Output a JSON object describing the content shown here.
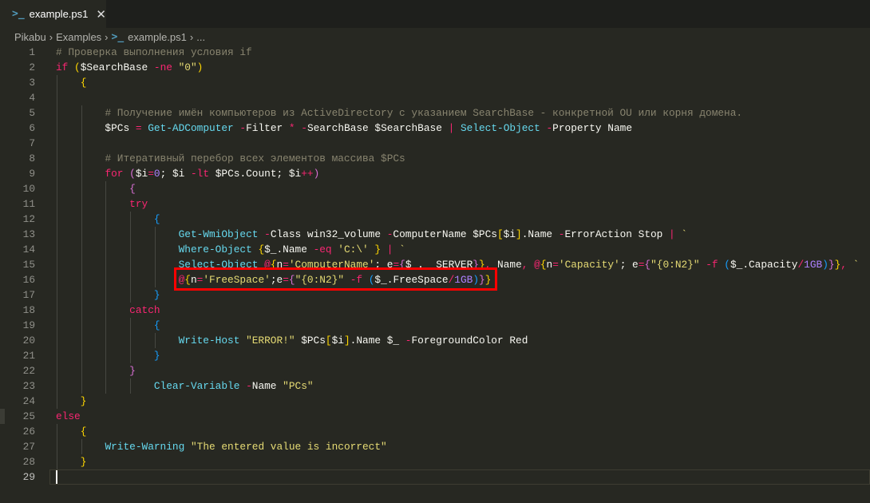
{
  "tab": {
    "icon": "powershell-icon",
    "title": "example.ps1",
    "close_icon": "close-icon"
  },
  "breadcrumb": [
    "Pikabu",
    "Examples",
    "example.ps1",
    "..."
  ],
  "editor": {
    "current_line": 29,
    "highlight_box_line": 16,
    "lines": [
      [
        [
          "c",
          "# Проверка выполнения условия if"
        ]
      ],
      [
        [
          "k",
          "if"
        ],
        [
          "v",
          " "
        ],
        [
          "b1",
          "("
        ],
        [
          "v",
          "$SearchBase "
        ],
        [
          "k",
          "-ne"
        ],
        [
          "v",
          " "
        ],
        [
          "s",
          "\"0\""
        ],
        [
          "b1",
          ")"
        ]
      ],
      [
        [
          "v",
          "    "
        ],
        [
          "b1",
          "{"
        ]
      ],
      [],
      [
        [
          "v",
          "        "
        ],
        [
          "c",
          "# Получение имён компьютеров из ActiveDirectory с указанием SearchBase - конкретной OU или корня домена."
        ]
      ],
      [
        [
          "v",
          "        $PCs "
        ],
        [
          "k",
          "="
        ],
        [
          "v",
          " "
        ],
        [
          "f",
          "Get-ADComputer"
        ],
        [
          "v",
          " "
        ],
        [
          "k",
          "-"
        ],
        [
          "v",
          "Filter "
        ],
        [
          "k",
          "*"
        ],
        [
          "v",
          " "
        ],
        [
          "k",
          "-"
        ],
        [
          "v",
          "SearchBase $SearchBase "
        ],
        [
          "k",
          "|"
        ],
        [
          "v",
          " "
        ],
        [
          "f",
          "Select-Object"
        ],
        [
          "v",
          " "
        ],
        [
          "k",
          "-"
        ],
        [
          "v",
          "Property Name"
        ]
      ],
      [],
      [
        [
          "v",
          "        "
        ],
        [
          "c",
          "# Итеративный перебор всех элементов массива $PCs"
        ]
      ],
      [
        [
          "v",
          "        "
        ],
        [
          "k",
          "for"
        ],
        [
          "v",
          " "
        ],
        [
          "b2",
          "("
        ],
        [
          "v",
          "$i"
        ],
        [
          "k",
          "="
        ],
        [
          "n",
          "0"
        ],
        [
          "v",
          "; $i "
        ],
        [
          "k",
          "-lt"
        ],
        [
          "v",
          " $PCs.Count; $i"
        ],
        [
          "k",
          "++"
        ],
        [
          "b2",
          ")"
        ]
      ],
      [
        [
          "v",
          "            "
        ],
        [
          "b2",
          "{"
        ]
      ],
      [
        [
          "v",
          "            "
        ],
        [
          "k",
          "try"
        ]
      ],
      [
        [
          "v",
          "                "
        ],
        [
          "b3",
          "{"
        ]
      ],
      [
        [
          "v",
          "                    "
        ],
        [
          "f",
          "Get-WmiObject"
        ],
        [
          "v",
          " "
        ],
        [
          "k",
          "-"
        ],
        [
          "v",
          "Class win32_volume "
        ],
        [
          "k",
          "-"
        ],
        [
          "v",
          "ComputerName $PCs"
        ],
        [
          "b1",
          "["
        ],
        [
          "v",
          "$i"
        ],
        [
          "b1",
          "]"
        ],
        [
          "v",
          ".Name "
        ],
        [
          "k",
          "-"
        ],
        [
          "v",
          "ErrorAction Stop "
        ],
        [
          "k",
          "|"
        ],
        [
          "v",
          " "
        ],
        [
          "s",
          "`"
        ]
      ],
      [
        [
          "v",
          "                    "
        ],
        [
          "f",
          "Where-Object"
        ],
        [
          "v",
          " "
        ],
        [
          "b1",
          "{"
        ],
        [
          "v",
          "$_.Name "
        ],
        [
          "k",
          "-eq"
        ],
        [
          "v",
          " "
        ],
        [
          "s",
          "'C:\\'"
        ],
        [
          "v",
          " "
        ],
        [
          "b1",
          "}"
        ],
        [
          "v",
          " "
        ],
        [
          "k",
          "|"
        ],
        [
          "v",
          " "
        ],
        [
          "s",
          "`"
        ]
      ],
      [
        [
          "v",
          "                    "
        ],
        [
          "f",
          "Select-Object"
        ],
        [
          "v",
          " "
        ],
        [
          "k",
          "@"
        ],
        [
          "b1",
          "{"
        ],
        [
          "v",
          "n"
        ],
        [
          "k",
          "="
        ],
        [
          "s",
          "'ComputerName'"
        ],
        [
          "v",
          "; e"
        ],
        [
          "k",
          "="
        ],
        [
          "b2",
          "{"
        ],
        [
          "v",
          "$_.__SERVER"
        ],
        [
          "b2",
          "}"
        ],
        [
          "b1",
          "}"
        ],
        [
          "k",
          ","
        ],
        [
          "v",
          " Name"
        ],
        [
          "k",
          ","
        ],
        [
          "v",
          " "
        ],
        [
          "k",
          "@"
        ],
        [
          "b1",
          "{"
        ],
        [
          "v",
          "n"
        ],
        [
          "k",
          "="
        ],
        [
          "s",
          "'Capacity'"
        ],
        [
          "v",
          "; e"
        ],
        [
          "k",
          "="
        ],
        [
          "b2",
          "{"
        ],
        [
          "s",
          "\"{0:N2}\""
        ],
        [
          "v",
          " "
        ],
        [
          "k",
          "-f"
        ],
        [
          "v",
          " "
        ],
        [
          "b3",
          "("
        ],
        [
          "v",
          "$_.Capacity"
        ],
        [
          "k",
          "/"
        ],
        [
          "n",
          "1GB"
        ],
        [
          "b3",
          ")"
        ],
        [
          "b2",
          "}"
        ],
        [
          "b1",
          "}"
        ],
        [
          "k",
          ","
        ],
        [
          "v",
          " "
        ],
        [
          "s",
          "`"
        ]
      ],
      [
        [
          "v",
          "                    "
        ],
        [
          "k",
          "@"
        ],
        [
          "b1",
          "{"
        ],
        [
          "v",
          "n"
        ],
        [
          "k",
          "="
        ],
        [
          "s",
          "'FreeSpace'"
        ],
        [
          "v",
          ";e"
        ],
        [
          "k",
          "="
        ],
        [
          "b2",
          "{"
        ],
        [
          "s",
          "\"{0:N2}\""
        ],
        [
          "v",
          " "
        ],
        [
          "k",
          "-f"
        ],
        [
          "v",
          " "
        ],
        [
          "b3",
          "("
        ],
        [
          "v",
          "$_.FreeSpace"
        ],
        [
          "k",
          "/"
        ],
        [
          "n",
          "1GB"
        ],
        [
          "b3",
          ")"
        ],
        [
          "b2",
          "}"
        ],
        [
          "b1",
          "}"
        ]
      ],
      [
        [
          "v",
          "                "
        ],
        [
          "b3",
          "}"
        ]
      ],
      [
        [
          "v",
          "            "
        ],
        [
          "k",
          "catch"
        ]
      ],
      [
        [
          "v",
          "                "
        ],
        [
          "b3",
          "{"
        ]
      ],
      [
        [
          "v",
          "                    "
        ],
        [
          "f",
          "Write-Host"
        ],
        [
          "v",
          " "
        ],
        [
          "s",
          "\"ERROR!\""
        ],
        [
          "v",
          " $PCs"
        ],
        [
          "b1",
          "["
        ],
        [
          "v",
          "$i"
        ],
        [
          "b1",
          "]"
        ],
        [
          "v",
          ".Name $_ "
        ],
        [
          "k",
          "-"
        ],
        [
          "v",
          "ForegroundColor Red"
        ]
      ],
      [
        [
          "v",
          "                "
        ],
        [
          "b3",
          "}"
        ]
      ],
      [
        [
          "v",
          "            "
        ],
        [
          "b2",
          "}"
        ]
      ],
      [
        [
          "v",
          "                "
        ],
        [
          "f",
          "Clear-Variable"
        ],
        [
          "v",
          " "
        ],
        [
          "k",
          "-"
        ],
        [
          "v",
          "Name "
        ],
        [
          "s",
          "\"PCs\""
        ]
      ],
      [
        [
          "v",
          "    "
        ],
        [
          "b1",
          "}"
        ]
      ],
      [
        [
          "k",
          "else"
        ]
      ],
      [
        [
          "v",
          "    "
        ],
        [
          "b1",
          "{"
        ]
      ],
      [
        [
          "v",
          "        "
        ],
        [
          "f",
          "Write-Warning"
        ],
        [
          "v",
          " "
        ],
        [
          "s",
          "\"The entered value is incorrect\""
        ]
      ],
      [
        [
          "v",
          "    "
        ],
        [
          "b1",
          "}"
        ]
      ],
      []
    ]
  },
  "colors": {
    "background": "#272822",
    "comment": "#88846f",
    "keyword": "#f92672",
    "cmdlet": "#66d9ef",
    "string": "#e6db74",
    "number": "#ae81ff",
    "highlight_box": "#ff0000"
  }
}
